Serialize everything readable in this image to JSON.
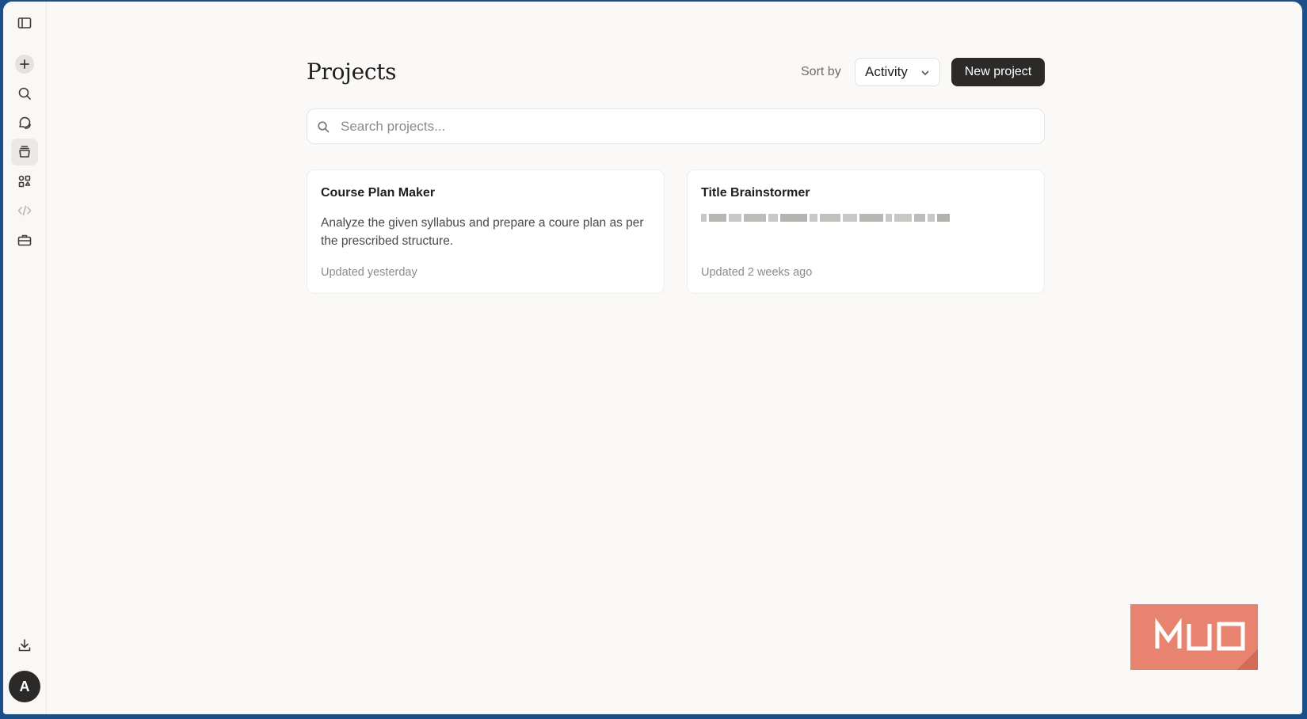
{
  "page": {
    "title": "Projects"
  },
  "sort": {
    "label": "Sort by",
    "selected": "Activity"
  },
  "toolbar": {
    "new_project_label": "New project"
  },
  "search": {
    "placeholder": "Search projects...",
    "value": ""
  },
  "sidebar": {
    "items": [
      {
        "icon": "sidebar-toggle-icon"
      },
      {
        "icon": "plus-icon"
      },
      {
        "icon": "search-icon"
      },
      {
        "icon": "chats-icon"
      },
      {
        "icon": "projects-icon",
        "active": true
      },
      {
        "icon": "artifacts-icon"
      },
      {
        "icon": "code-icon"
      },
      {
        "icon": "toolbox-icon"
      },
      {
        "icon": "download-icon"
      }
    ],
    "avatar_initial": "A"
  },
  "projects": [
    {
      "title": "Course Plan Maker",
      "description": "Analyze the given syllabus and prepare a coure plan as per the prescribed structure.",
      "updated": "Updated yesterday"
    },
    {
      "title": "Title Brainstormer",
      "description": "",
      "updated": "Updated 2 weeks ago"
    }
  ],
  "watermark": {
    "text": "MUO",
    "color": "#e8836f"
  },
  "colors": {
    "accent_dark": "#2b2a28",
    "background": "#faf9f7",
    "frame": "#1b4f8a"
  }
}
